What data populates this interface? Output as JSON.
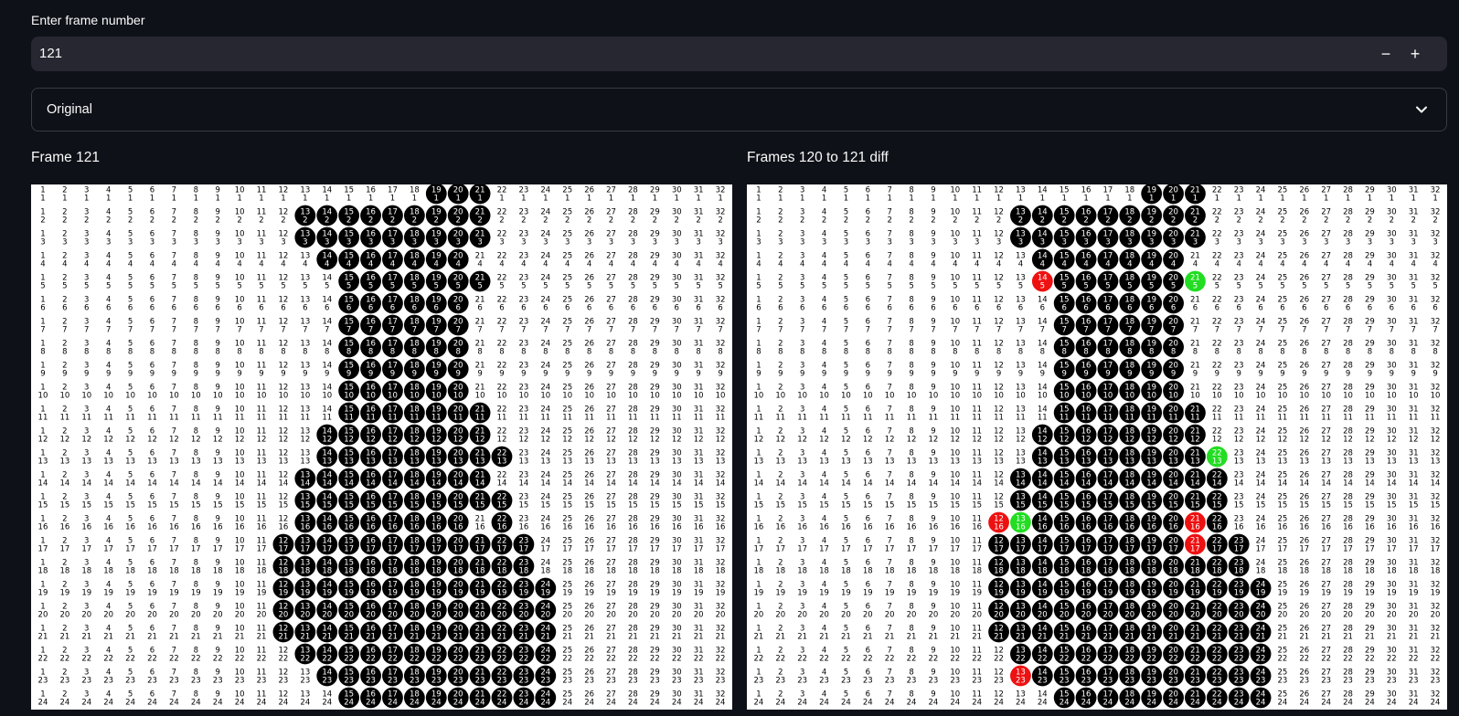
{
  "frame_input": {
    "label": "Enter frame number",
    "value": "121",
    "decrement": "−",
    "increment": "+"
  },
  "view_select": {
    "value": "Original"
  },
  "left_panel": {
    "title": "Frame 121"
  },
  "right_panel": {
    "title": "Frames 120 to 121 diff"
  },
  "grid": {
    "columns": 32,
    "rows_visible": 24,
    "fill_color": "#000000",
    "added_color": "#22dd22",
    "removed_color": "#ee1111",
    "frame_filled": [
      [
        19,
        21
      ],
      [
        13,
        21
      ],
      [
        13,
        21
      ],
      [
        14,
        20
      ],
      [
        15,
        21
      ],
      [
        15,
        20
      ],
      [
        15,
        20
      ],
      [
        15,
        20
      ],
      [
        15,
        20
      ],
      [
        15,
        20
      ],
      [
        15,
        21
      ],
      [
        14,
        21
      ],
      [
        14,
        22
      ],
      [
        13,
        21
      ],
      [
        13,
        22
      ],
      [
        13,
        20,
        22,
        22
      ],
      [
        12,
        23
      ],
      [
        12,
        23
      ],
      [
        12,
        24
      ],
      [
        12,
        24
      ],
      [
        12,
        24
      ],
      [
        13,
        24
      ],
      [
        14,
        24
      ],
      [
        15,
        24
      ]
    ],
    "diff_filled": [
      [
        19,
        21
      ],
      [
        13,
        21
      ],
      [
        13,
        21
      ],
      [
        14,
        20
      ],
      [
        15,
        20
      ],
      [
        15,
        20
      ],
      [
        15,
        20
      ],
      [
        15,
        20
      ],
      [
        15,
        20
      ],
      [
        15,
        20
      ],
      [
        15,
        21
      ],
      [
        14,
        21
      ],
      [
        14,
        21
      ],
      [
        13,
        22
      ],
      [
        13,
        22
      ],
      [
        14,
        20,
        22,
        22
      ],
      [
        12,
        23
      ],
      [
        12,
        23
      ],
      [
        12,
        24
      ],
      [
        12,
        24
      ],
      [
        12,
        24
      ],
      [
        13,
        24
      ],
      [
        14,
        24
      ],
      [
        15,
        24
      ]
    ],
    "diff_added": [
      [
        5,
        21
      ],
      [
        13,
        22
      ],
      [
        16,
        13
      ]
    ],
    "diff_removed": [
      [
        5,
        14
      ],
      [
        16,
        12
      ],
      [
        16,
        21
      ],
      [
        17,
        21
      ],
      [
        23,
        13
      ]
    ]
  }
}
